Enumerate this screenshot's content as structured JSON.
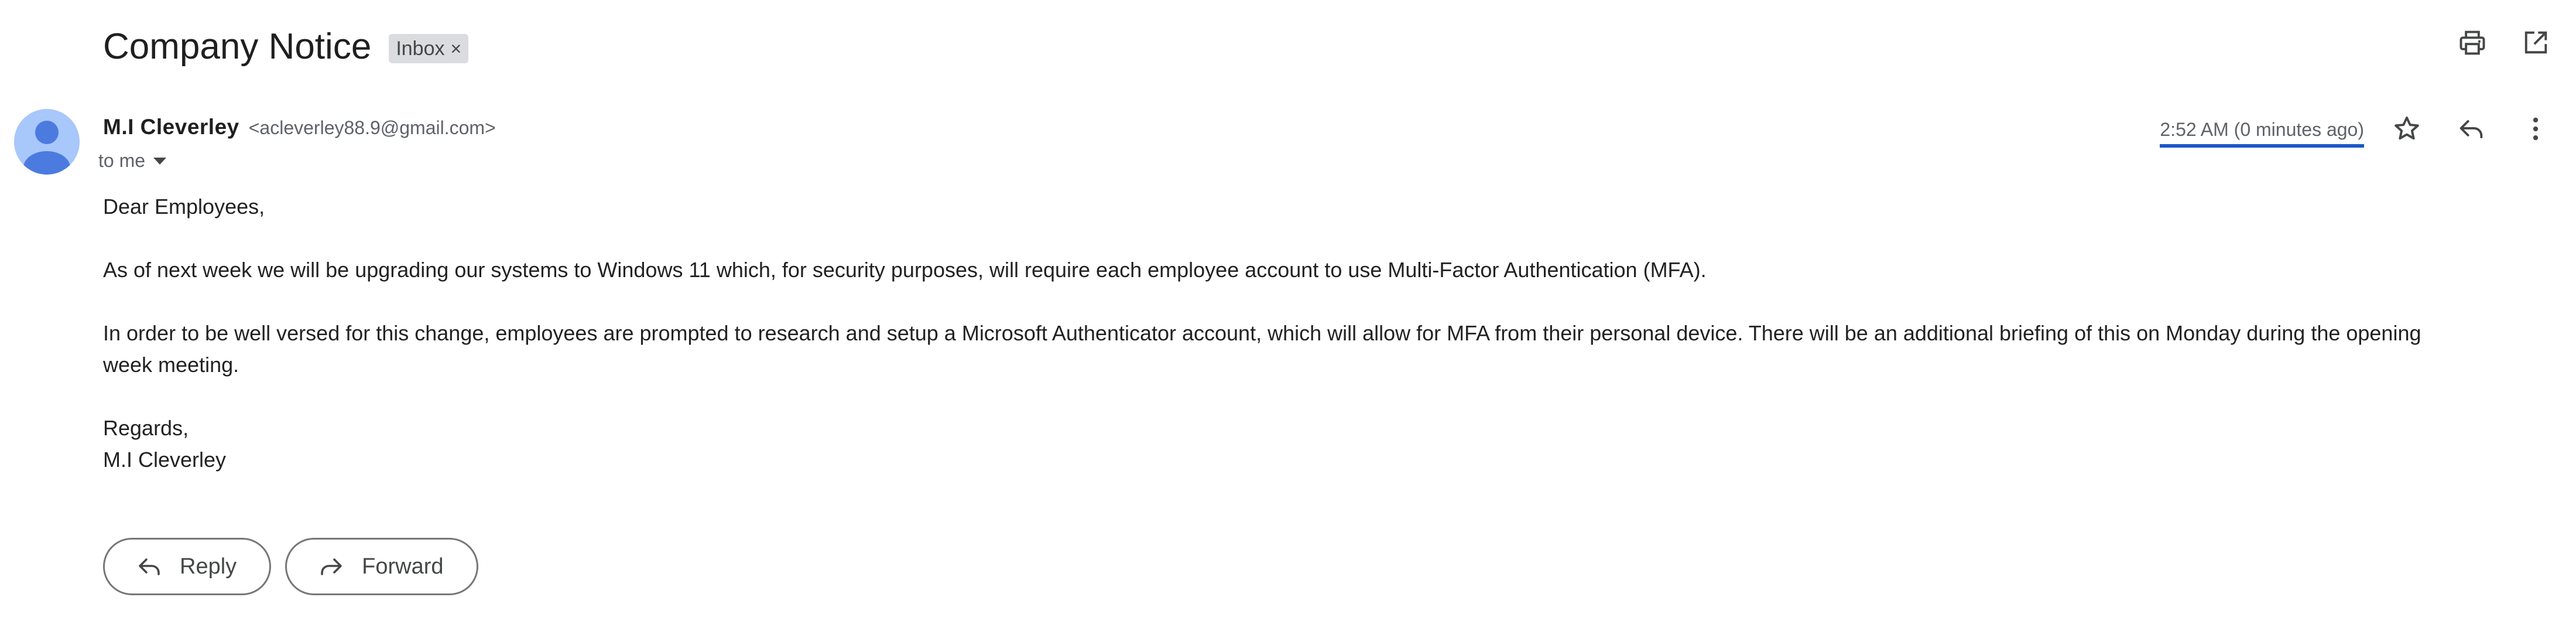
{
  "email": {
    "subject": "Company Notice",
    "label": "Inbox",
    "label_remove": "×",
    "sender_name": "M.I Cleverley",
    "sender_email": "<acleverley88.9@gmail.com>",
    "recipient": "to me",
    "timestamp": "2:52 AM (0 minutes ago)"
  },
  "body": {
    "greeting": "Dear Employees,",
    "paragraph1": "As of next week we will be upgrading our systems to Windows 11 which, for security purposes, will require each employee account to use Multi-Factor Authentication (MFA).",
    "paragraph2": "In order to be well versed for this change, employees are prompted to research and setup a Microsoft Authenticator account, which will allow for MFA from their personal device. There will be an additional briefing of this on Monday during the opening week meeting.",
    "closing": "Regards,",
    "signature": "M.I Cleverley"
  },
  "actions": {
    "reply_label": "Reply",
    "forward_label": "Forward"
  },
  "icons": {
    "print": "print-icon",
    "open_new_window": "open-in-new-window-icon",
    "star": "star-icon",
    "reply": "reply-icon",
    "more": "more-vertical-icon",
    "forward": "forward-icon",
    "caret": "chevron-down-icon"
  },
  "colors": {
    "avatar_bg": "#a8c7fa",
    "avatar_fg": "#4c7be0",
    "timestamp_underline": "#1a57c8",
    "chip_bg": "#dadce0"
  }
}
